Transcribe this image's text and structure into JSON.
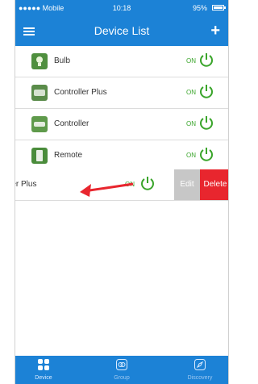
{
  "status_bar": {
    "carrier": "●●●●● Mobile",
    "time": "10:18",
    "battery": "95%"
  },
  "nav": {
    "title": "Device List",
    "add": "+"
  },
  "devices": [
    {
      "label": "Bulb",
      "state": "ON"
    },
    {
      "label": "Controller Plus",
      "state": "ON"
    },
    {
      "label": "Controller",
      "state": "ON"
    },
    {
      "label": "Remote",
      "state": "ON"
    }
  ],
  "swiped_row": {
    "label": "roller Plus",
    "state": "ON",
    "edit": "Edit",
    "delete": "Delete"
  },
  "tabs": [
    {
      "label": "Device",
      "icon": "device-grid-icon"
    },
    {
      "label": "Group",
      "icon": "group-icon"
    },
    {
      "label": "Discovery",
      "icon": "compass-icon"
    }
  ],
  "colors": {
    "primary": "#1c82d6",
    "on_green": "#3aa52b",
    "delete_red": "#e8262e",
    "edit_gray": "#c7c7c7",
    "arrow_red": "#e8262e"
  }
}
